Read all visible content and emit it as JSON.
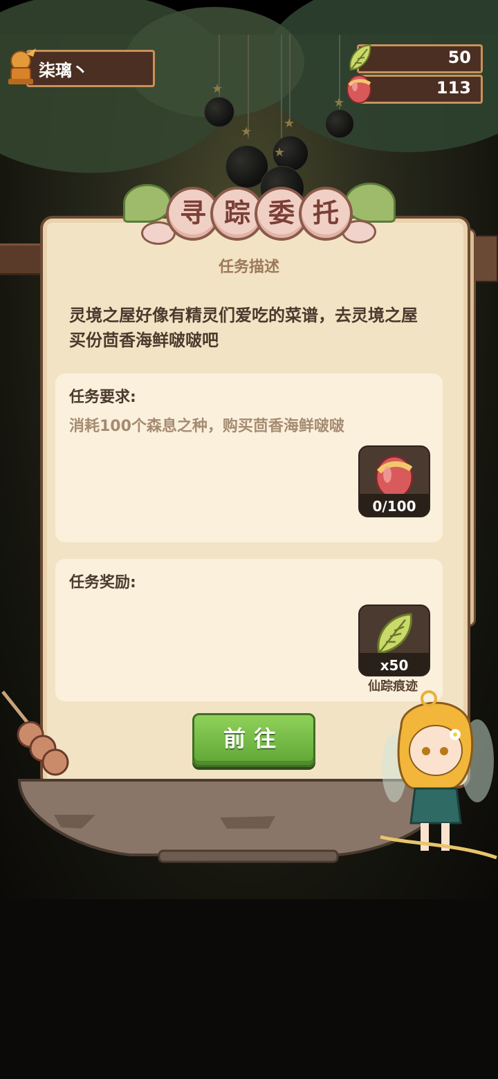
{
  "player": {
    "name": "柒璃丶"
  },
  "currency": {
    "leaf": {
      "value": "50",
      "icon": "fairy-leaf-icon"
    },
    "seed": {
      "value": "113",
      "icon": "forest-seed-icon"
    }
  },
  "panel": {
    "title_chars": [
      "寻",
      "踪",
      "委",
      "托"
    ],
    "subtitle": "任务描述",
    "description": "灵境之屋好像有精灵们爱吃的菜谱，去灵境之屋买份茴香海鲜啵啵吧",
    "requirement": {
      "title": "任务要求:",
      "text": "消耗100个森息之种，购买茴香海鲜啵啵",
      "item_count": "0/100",
      "item_icon": "forest-seed-icon"
    },
    "reward": {
      "title": "任务奖励:",
      "item_count": "x50",
      "item_name": "仙踪痕迹",
      "item_icon": "fairy-leaf-icon"
    },
    "go_button": "前往"
  },
  "colors": {
    "button_green": "#6fba42",
    "panel_bg": "#f3e3c5",
    "frame_brown": "#6b4a35"
  }
}
